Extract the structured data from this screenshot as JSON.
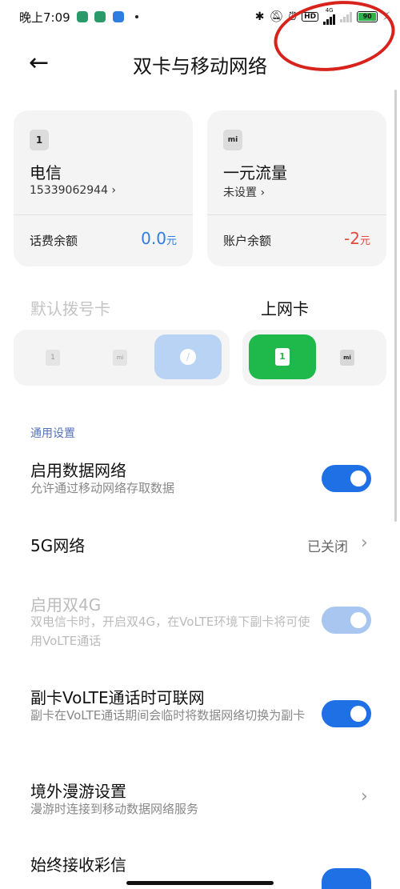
{
  "status": {
    "time": "晚上7:09",
    "net_4g": "4G",
    "battery": "90",
    "hd": "HD"
  },
  "header": {
    "back": "←",
    "title": "双卡与移动网络"
  },
  "cards": [
    {
      "badge": "1",
      "name": "电信",
      "sub": "15339062944 ›",
      "balance_label": "话费余额",
      "balance_value": "0.0",
      "balance_unit": "元",
      "balance_color": "#2f7de1"
    },
    {
      "badge": "mi",
      "name": "一元流量",
      "sub": "未设置 ›",
      "balance_label": "账户余额",
      "balance_value": "-2",
      "balance_unit": "元",
      "balance_color": "#e04a3f"
    }
  ],
  "selectors": {
    "dial_label": "默认拨号卡",
    "data_label": "上网卡",
    "sim1": "1",
    "sim2": "mi"
  },
  "settings": {
    "section": "通用设置",
    "mobile_data": {
      "title": "启用数据网络",
      "desc": "允许通过移动网络存取数据",
      "on": true
    },
    "5g": {
      "title": "5G网络",
      "value": "已关闭"
    },
    "dual4g": {
      "title": "启用双4G",
      "desc": "双电信卡时，开启双4G，在VoLTE环境下副卡将可使用VoLTE通话",
      "on": true,
      "disabled": true
    },
    "sub_volte": {
      "title": "副卡VoLTE通话时可联网",
      "desc": "副卡在VoLTE通话期间会临时将数据网络切换为副卡",
      "on": true
    },
    "roaming": {
      "title": "境外漫游设置",
      "desc": "漫游时连接到移动数据网络服务"
    },
    "mms": {
      "title": "始终接收彩信"
    }
  },
  "colors": {
    "accent": "#1f6fe5",
    "sim_green": "#1fb94b",
    "annotation_red": "#d8221c"
  }
}
